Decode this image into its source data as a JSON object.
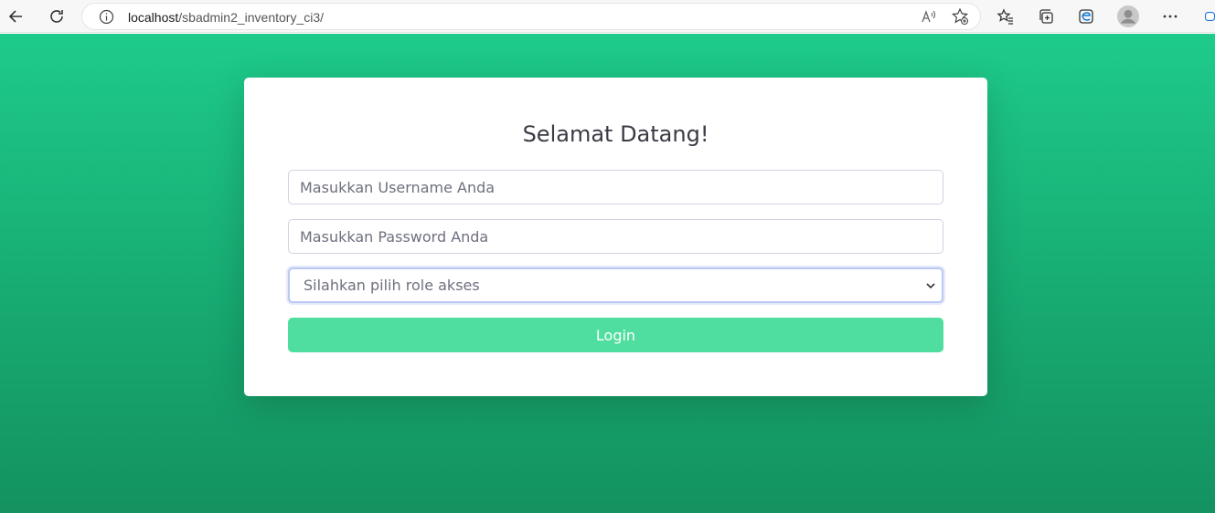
{
  "browser": {
    "url_host": "localhost",
    "url_path": "/sbadmin2_inventory_ci3/"
  },
  "login": {
    "title": "Selamat Datang!",
    "username_placeholder": "Masukkan Username Anda",
    "password_placeholder": "Masukkan Password Anda",
    "role_selected": "Silahkan pilih role akses",
    "button_label": "Login"
  },
  "colors": {
    "background_top": "#1ecb8a",
    "background_bottom": "#14925f",
    "button": "#4fde9f"
  }
}
